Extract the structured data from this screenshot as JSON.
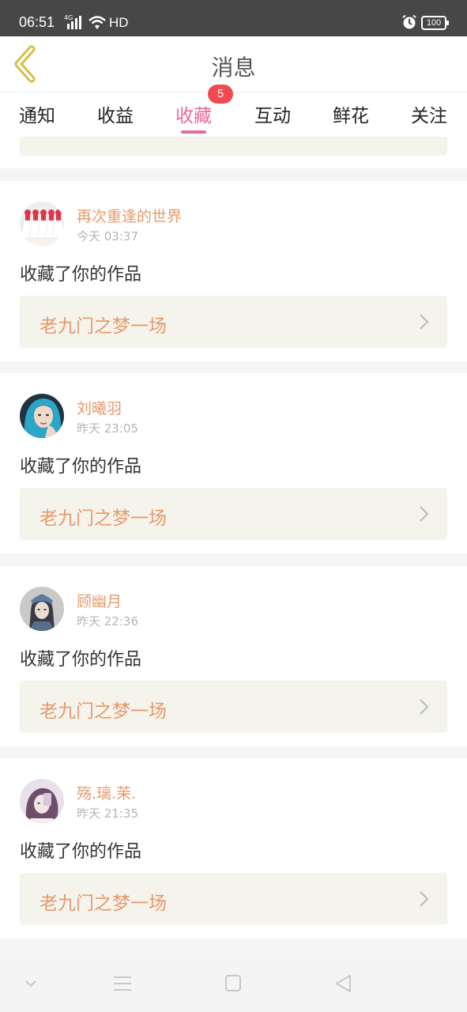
{
  "status_bar": {
    "time": "06:51",
    "network": "4G",
    "hd": "HD",
    "battery": "100",
    "icons": [
      "signal-icon",
      "wifi-icon",
      "alarm-icon",
      "battery-icon"
    ]
  },
  "header": {
    "title": "消息",
    "back_icon": "chevron-left-icon"
  },
  "tabs": [
    {
      "label": "通知"
    },
    {
      "label": "收益"
    },
    {
      "label": "收藏",
      "active": true,
      "badge": "5"
    },
    {
      "label": "互动"
    },
    {
      "label": "鲜花"
    },
    {
      "label": "关注"
    }
  ],
  "messages": [
    {
      "username": "再次重逢的世界",
      "time": "今天 03:37",
      "action": "收藏了你的作品",
      "work_title": "老九门之梦一场"
    },
    {
      "username": "刘曦羽",
      "time": "昨天 23:05",
      "action": "收藏了你的作品",
      "work_title": "老九门之梦一场"
    },
    {
      "username": "顾幽月",
      "time": "昨天 22:36",
      "action": "收藏了你的作品",
      "work_title": "老九门之梦一场"
    },
    {
      "username": "殇.璃.茉.",
      "time": "昨天 21:35",
      "action": "收藏了你的作品",
      "work_title": "老九门之梦一场"
    }
  ],
  "colors": {
    "accent": "#e56a9f",
    "badge": "#f0494f",
    "username": "#e89a6c",
    "link_bg": "#f4f3ec"
  },
  "nav_icons": [
    "chevron-down-icon",
    "menu-icon",
    "home-square-icon",
    "back-triangle-icon"
  ]
}
